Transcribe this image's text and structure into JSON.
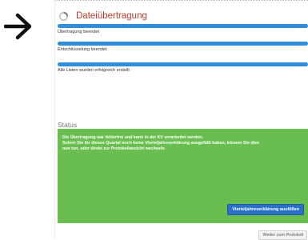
{
  "header": {
    "title": "Dateiübertragung"
  },
  "steps": [
    {
      "label": "Übertragung beendet",
      "progress": 1.0
    },
    {
      "label": "Entschlüsselung beendet",
      "progress": 1.0
    },
    {
      "label": "Alle Listen wurden erfolgreich erstellt",
      "progress": 1.0
    }
  ],
  "status": {
    "heading": "Status",
    "line1": "Die Übertragung war fehlerfrei und kann in der KV verarbeitet werden.",
    "line2": "Sofern Sie für dieses Quartal noch keine Vierteljahreserklärung ausgefüllt haben, können Sie dies",
    "line3": "nun tun, oder direkt zur Protokollansicht wechseln.",
    "action_label": "Vierteljahreserklärung ausfüllen"
  },
  "footer": {
    "next_label": "Weiter zum Protokoll"
  },
  "colors": {
    "accent": "#c0392b",
    "progress": "#2f8fdc",
    "status_bg": "#6abd4f",
    "button": "#2a72c9"
  },
  "icons": {
    "pointer": "arrow-right-icon",
    "busy": "spinner-icon"
  }
}
